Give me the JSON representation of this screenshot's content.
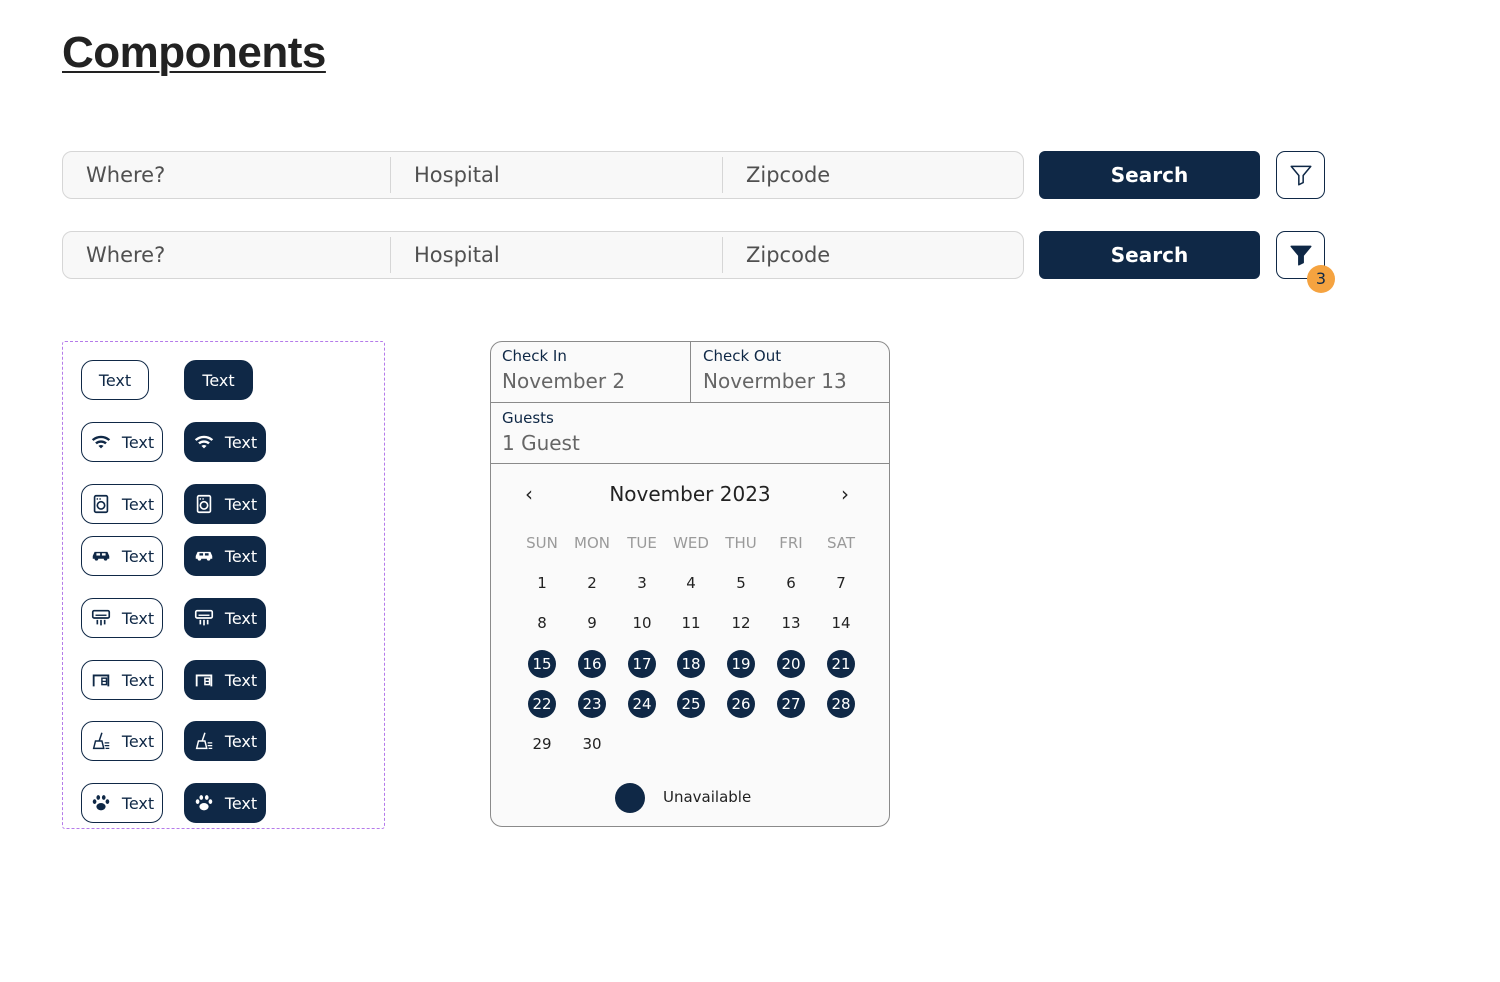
{
  "page": {
    "title": "Components"
  },
  "search_bars": [
    {
      "where_placeholder": "Where?",
      "hospital_placeholder": "Hospital",
      "zipcode_placeholder": "Zipcode",
      "button_label": "Search",
      "filter_active": false
    },
    {
      "where_placeholder": "Where?",
      "hospital_placeholder": "Hospital",
      "zipcode_placeholder": "Zipcode",
      "button_label": "Search",
      "filter_active": true,
      "filter_count": "3"
    }
  ],
  "chips": {
    "items": [
      {
        "icon": "none",
        "label": "Text"
      },
      {
        "icon": "wifi-icon",
        "label": "Text"
      },
      {
        "icon": "washer-icon",
        "label": "Text"
      },
      {
        "icon": "car-icon",
        "label": "Text"
      },
      {
        "icon": "air-conditioner-icon",
        "label": "Text"
      },
      {
        "icon": "garage-icon",
        "label": "Text"
      },
      {
        "icon": "cleaning-broom-icon",
        "label": "Text"
      },
      {
        "icon": "paw-icon",
        "label": "Text"
      }
    ]
  },
  "booking": {
    "check_in_label": "Check In",
    "check_in_value": "November 2",
    "check_out_label": "Check Out",
    "check_out_value": "Novermber 13",
    "guests_label": "Guests",
    "guests_value": "1 Guest",
    "month_label": "November 2023",
    "prev_icon": "‹",
    "next_icon": "›",
    "weekdays": [
      "SUN",
      "MON",
      "TUE",
      "WED",
      "THU",
      "FRI",
      "SAT"
    ],
    "weeks": [
      [
        "1",
        "2",
        "3",
        "4",
        "5",
        "6",
        "7"
      ],
      [
        "8",
        "9",
        "10",
        "11",
        "12",
        "13",
        "14"
      ],
      [
        "15",
        "16",
        "17",
        "18",
        "19",
        "20",
        "21"
      ],
      [
        "22",
        "23",
        "24",
        "25",
        "26",
        "27",
        "28"
      ],
      [
        "29",
        "30"
      ]
    ],
    "unavailable_days": [
      "15",
      "16",
      "17",
      "18",
      "19",
      "20",
      "21",
      "22",
      "23",
      "24",
      "25",
      "26",
      "27",
      "28"
    ],
    "legend_label": "Unavailable"
  },
  "colors": {
    "primary": "#0f2846",
    "badge": "#f5a340",
    "dashed_border": "#b57bea"
  }
}
